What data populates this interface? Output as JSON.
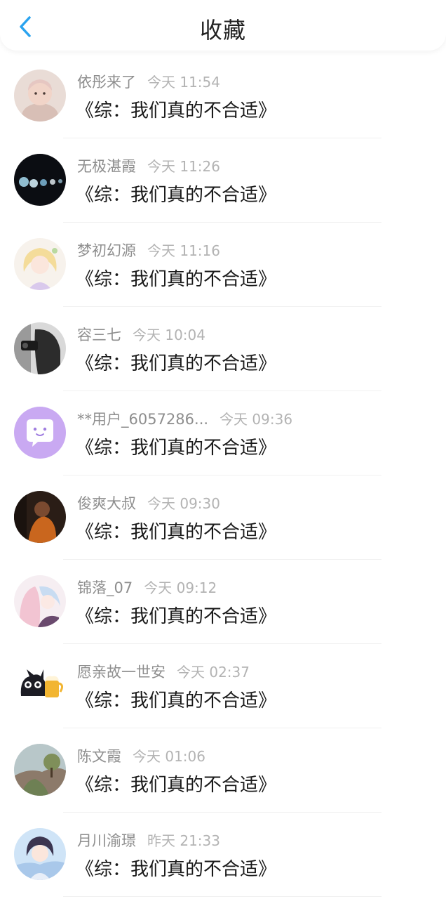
{
  "header": {
    "title": "收藏",
    "back_icon": "chevron-left-icon",
    "accent_color": "#2aa3ef"
  },
  "items": [
    {
      "username": "依彤来了",
      "time": "今天 11:54",
      "title": "《综：我们真的不合适》",
      "avatar": "baby-photo"
    },
    {
      "username": "无极湛霞",
      "time": "今天 11:26",
      "title": "《综：我们真的不合适》",
      "avatar": "night-bokeh-lights"
    },
    {
      "username": "梦初幻源",
      "time": "今天 11:16",
      "title": "《综：我们真的不合适》",
      "avatar": "anime-blonde-girl"
    },
    {
      "username": "容三七",
      "time": "今天 10:04",
      "title": "《综：我们真的不合适》",
      "avatar": "bw-photographer-girl"
    },
    {
      "username": "**用户_6057286...",
      "time": "今天 09:36",
      "title": "《综：我们真的不合适》",
      "avatar": "default-chat-bubble"
    },
    {
      "username": "俊爽大叔",
      "time": "今天 09:30",
      "title": "《综：我们真的不合适》",
      "avatar": "person-dark-photo"
    },
    {
      "username": "锦落_07",
      "time": "今天 09:12",
      "title": "《综：我们真的不合适》",
      "avatar": "anime-pink-couple"
    },
    {
      "username": "愿亲故一世安",
      "time": "今天 02:37",
      "title": "《综：我们真的不合适》",
      "avatar": "cartoon-cat-beer"
    },
    {
      "username": "陈文霞",
      "time": "今天 01:06",
      "title": "《综：我们真的不合适》",
      "avatar": "landscape-tree"
    },
    {
      "username": "月川渝璟",
      "time": "昨天 21:33",
      "title": "《综：我们真的不合适》",
      "avatar": "anime-boy-sky"
    }
  ]
}
